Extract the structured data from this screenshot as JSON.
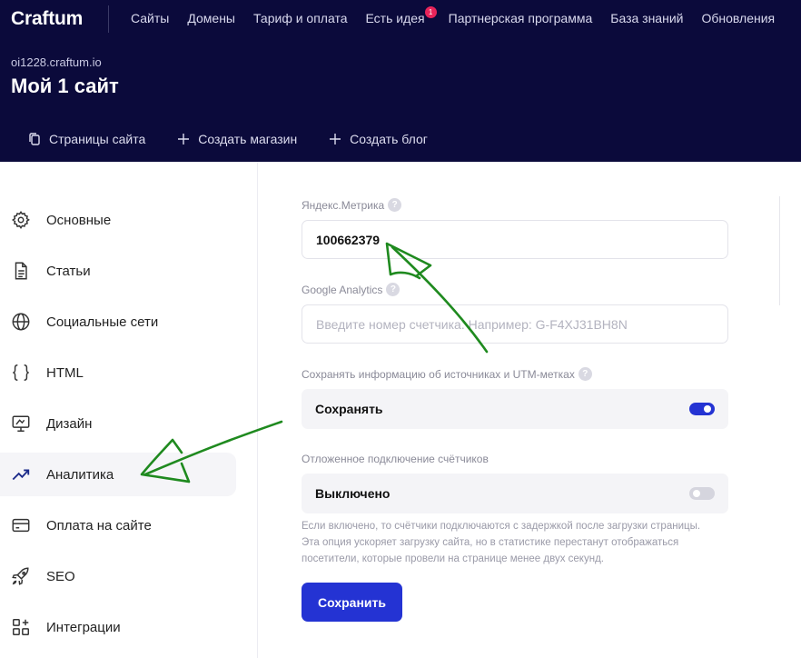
{
  "header": {
    "logo": "Craftum",
    "nav": [
      {
        "label": "Сайты"
      },
      {
        "label": "Домены"
      },
      {
        "label": "Тариф и оплата"
      },
      {
        "label": "Есть идея",
        "badge": "1"
      },
      {
        "label": "Партнерская программа"
      },
      {
        "label": "База знаний"
      },
      {
        "label": "Обновления"
      }
    ],
    "site_domain": "oi1228.craftum.io",
    "site_title": "Мой 1 сайт",
    "subnav": [
      {
        "label": "Страницы сайта",
        "icon": "copy-icon"
      },
      {
        "label": "Создать магазин",
        "icon": "plus-icon"
      },
      {
        "label": "Создать блог",
        "icon": "plus-icon"
      }
    ]
  },
  "sidebar": {
    "items": [
      {
        "label": "Основные",
        "icon": "gear-icon"
      },
      {
        "label": "Статьи",
        "icon": "document-icon"
      },
      {
        "label": "Социальные сети",
        "icon": "globe-icon"
      },
      {
        "label": "HTML",
        "icon": "braces-icon"
      },
      {
        "label": "Дизайн",
        "icon": "design-icon"
      },
      {
        "label": "Аналитика",
        "icon": "trending-up-icon",
        "active": true
      },
      {
        "label": "Оплата на сайте",
        "icon": "card-icon"
      },
      {
        "label": "SEO",
        "icon": "rocket-icon"
      },
      {
        "label": "Интеграции",
        "icon": "grid-icon"
      }
    ]
  },
  "main": {
    "yandex": {
      "label": "Яндекс.Метрика",
      "value": "100662379",
      "help": "?"
    },
    "google": {
      "label": "Google Analytics",
      "placeholder": "Введите номер счетчика. Например: G-F4XJ31BH8N",
      "help": "?"
    },
    "utm": {
      "label": "Сохранять информацию об источниках и UTM-метках",
      "toggle_label": "Сохранять",
      "enabled": true,
      "help": "?"
    },
    "delayed": {
      "label": "Отложенное подключение счётчиков",
      "toggle_label": "Выключено",
      "enabled": false
    },
    "hint": "Если включено, то счётчики подключаются с задержкой после загрузки страницы. Эта опция ускоряет загрузку сайта, но в статистике перестанут отображаться посетители, которые провели на странице менее двух секунд.",
    "save_label": "Сохранить"
  },
  "colors": {
    "header_bg": "#0b0a3b",
    "accent": "#2433d3",
    "badge": "#e8245a",
    "annotation": "#1f8a1f"
  }
}
